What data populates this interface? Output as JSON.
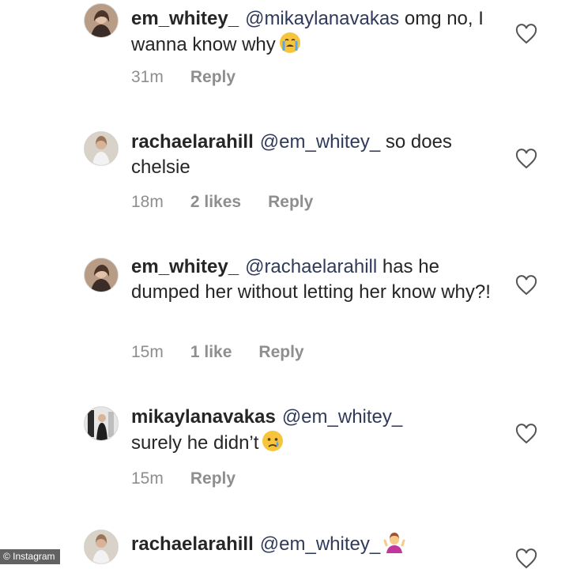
{
  "comments": [
    {
      "username": "em_whitey_",
      "mention": "@mikaylanavakas",
      "body": " omg no, I wanna know why",
      "emoji": "crying-face",
      "time": "31m",
      "likes": "",
      "reply": "Reply"
    },
    {
      "username": "rachaelarahill",
      "mention": "@em_whitey_",
      "body": " so does chelsie",
      "emoji": "",
      "time": "18m",
      "likes": "2 likes",
      "reply": "Reply"
    },
    {
      "username": "em_whitey_",
      "mention": "@rachaelarahill",
      "body": " has he dumped her without letting her know why?!",
      "emoji": "",
      "time": "15m",
      "likes": "1 like",
      "reply": "Reply"
    },
    {
      "username": "mikaylanavakas",
      "mention": "@em_whitey_",
      "body": " surely he didn’t",
      "emoji": "sad-tear-face",
      "time": "15m",
      "likes": "",
      "reply": "Reply"
    },
    {
      "username": "rachaelarahill",
      "mention": "@em_whitey_",
      "body": "",
      "emoji": "person-shrugging",
      "time": "",
      "likes": "",
      "reply": ""
    }
  ],
  "watermark": "© Instagram",
  "colors": {
    "text": "#262626",
    "meta": "#8e8e8e",
    "mention": "#303a5a"
  }
}
